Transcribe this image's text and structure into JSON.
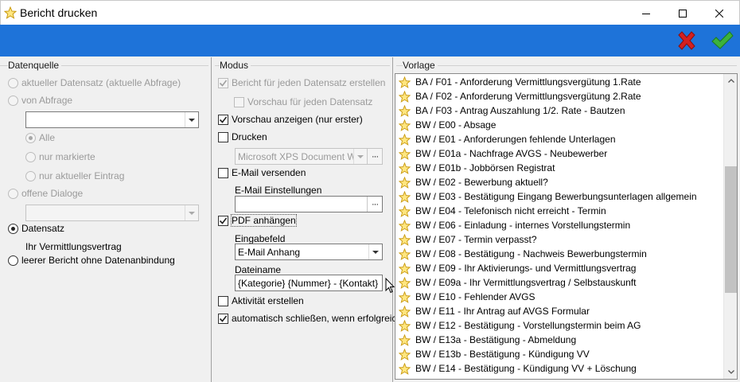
{
  "window": {
    "title": "Bericht drucken",
    "icon": "star-icon",
    "controls": [
      "minimize-icon",
      "maximize-icon",
      "close-icon"
    ]
  },
  "toolbar": {
    "cancel_icon": "red-x-icon",
    "ok_icon": "green-check-icon",
    "cancel_color": "#d42020",
    "ok_color": "#3cb23c",
    "background": "#1e73d9"
  },
  "datenquelle": {
    "legend": "Datenquelle",
    "aktueller_datensatz": "aktueller Datensatz (aktuelle Abfrage)",
    "von_abfrage": "von Abfrage",
    "abfrage_value": "",
    "alle": "Alle",
    "nur_markierte": "nur markierte",
    "nur_aktueller_eintrag": "nur aktueller Eintrag",
    "offene_dialoge": "offene Dialoge",
    "dialoge_value": "",
    "datensatz": "Datensatz",
    "datensatz_name": "Ihr Vermittlungsvertrag",
    "leerer_bericht": "leerer Bericht ohne Datenanbindung",
    "selected": "Datensatz"
  },
  "modus": {
    "legend": "Modus",
    "bericht_je_datensatz": "Bericht für jeden Datensatz erstellen",
    "vorschau_je_datensatz": "Vorschau für jeden Datensatz",
    "vorschau_anzeigen": "Vorschau anzeigen (nur erster)",
    "drucken": "Drucken",
    "drucker": "Microsoft XPS Document Wr...",
    "email_versenden": "E-Mail versenden",
    "email_einstellungen_label": "E-Mail Einstellungen",
    "email_einstellungen_value": "",
    "pdf_anhaengen": "PDF anhängen",
    "eingabefeld_label": "Eingabefeld",
    "eingabefeld_value": "E-Mail Anhang",
    "dateiname_label": "Dateiname",
    "dateiname_value": "{Kategorie} {Nummer} - {Kontakt}",
    "aktivitaet_erstellen": "Aktivität erstellen",
    "automatisch_schliessen": "automatisch schließen, wenn erfolgreich",
    "checked": {
      "bericht_je_datensatz": true,
      "vorschau_je_datensatz": false,
      "vorschau_anzeigen": true,
      "drucken": false,
      "email_versenden": false,
      "pdf_anhaengen": true,
      "aktivitaet_erstellen": false,
      "automatisch_schliessen": true
    }
  },
  "vorlage": {
    "legend": "Vorlage",
    "item_icon": "star-icon",
    "items": [
      "BA / F01 - Anforderung Vermittlungsvergütung 1.Rate",
      "BA / F02 - Anforderung Vermittlungsvergütung 2.Rate",
      "BA / F03 - Antrag Auszahlung 1/2. Rate - Bautzen",
      "BW / E00 - Absage",
      "BW / E01 - Anforderungen fehlende Unterlagen",
      "BW / E01a - Nachfrage AVGS - Neubewerber",
      "BW / E01b - Jobbörsen Registrat",
      "BW / E02 - Bewerbung aktuell?",
      "BW / E03 - Bestätigung Eingang Bewerbungsunterlagen allgemein",
      "BW / E04 - Telefonisch nicht erreicht - Termin",
      "BW / E06 - Einladung - internes Vorstellungstermin",
      "BW / E07 - Termin verpasst?",
      "BW / E08 - Bestätigung - Nachweis Bewerbungstermin",
      "BW / E09 - Ihr Aktivierungs- und Vermittlungsvertrag",
      "BW / E09a - Ihr Vermittlungsvertrag / Selbstauskunft",
      "BW / E10 - Fehlender AVGS",
      "BW / E11 - Ihr Antrag auf AVGS Formular",
      "BW / E12 - Bestätigung - Vorstellungstermin beim AG",
      "BW / E13a - Bestätigung - Abmeldung",
      "BW / E13b - Bestätigung - Kündigung VV",
      "BW / E14 - Bestätigung - Kündigung VV + Löschung"
    ]
  }
}
